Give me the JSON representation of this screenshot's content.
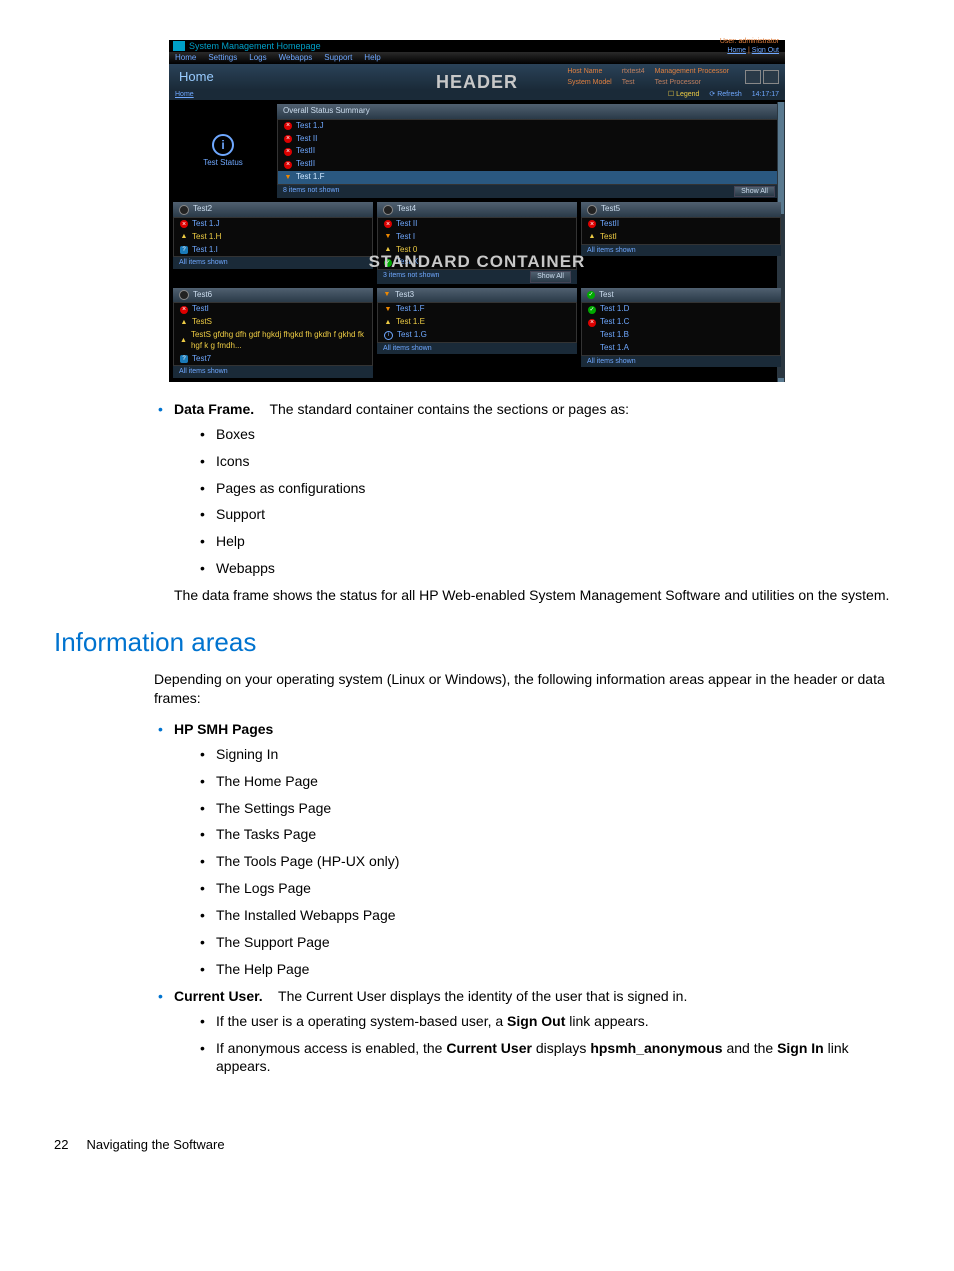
{
  "figure": {
    "app_title": "System Management Homepage",
    "top_right": {
      "user_label": "User: administrator",
      "home": "Home",
      "sign_out": "Sign Out"
    },
    "menu": [
      "Home",
      "Settings",
      "Logs",
      "Webapps",
      "Support",
      "Help"
    ],
    "page_name": "Home",
    "header_overlay": "HEADER",
    "host_info": {
      "host_name_label": "Host Name",
      "host_name": "rtxtest4",
      "system_model_label": "System Model",
      "system_model": "Test",
      "mp_label": "Management Processor",
      "mp_value": "Test Processor"
    },
    "breadcrumb": "Home",
    "strip_right": {
      "legend": "Legend",
      "refresh": "Refresh",
      "time": "14:17:17"
    },
    "test_status_label": "Test Status",
    "summary": {
      "title": "Overall Status Summary",
      "items": [
        {
          "icon": "crit",
          "label": "Test 1.J"
        },
        {
          "icon": "crit",
          "label": "Test II"
        },
        {
          "icon": "crit",
          "label": "TestII"
        },
        {
          "icon": "crit",
          "label": "TestII"
        },
        {
          "icon": "warn-maj",
          "label": "Test 1.F",
          "sel": true
        }
      ],
      "footer_left": "8 items not shown",
      "footer_btn": "Show All"
    },
    "container_overlay": "STANDARD CONTAINER",
    "grid": {
      "row1": [
        {
          "hdr_icon": "dis",
          "title": "Test2",
          "items": [
            {
              "icon": "crit",
              "label": "Test 1.J"
            },
            {
              "icon": "warn-min",
              "label": "Test 1.H",
              "cls": "warn-line"
            },
            {
              "icon": "unk",
              "label": "Test 1.I"
            }
          ],
          "ftr": "All items shown"
        },
        {
          "hdr_icon": "dis",
          "title": "Test4",
          "items": [
            {
              "icon": "crit",
              "label": "Test II"
            },
            {
              "icon": "warn-maj",
              "label": "Test I"
            },
            {
              "icon": "warn-min",
              "label": "Test 0",
              "cls": "warn-line"
            },
            {
              "icon": "ok",
              "label": "Test X"
            }
          ],
          "ftr": "3 items not shown",
          "btn": "Show All"
        },
        {
          "hdr_icon": "dis",
          "title": "Test5",
          "items": [
            {
              "icon": "crit",
              "label": "TestII"
            },
            {
              "icon": "warn-min",
              "label": "TestI",
              "cls": "warn-line"
            }
          ],
          "ftr": "All items shown"
        }
      ],
      "row2": [
        {
          "hdr_icon": "dis",
          "title": "Test6",
          "items": [
            {
              "icon": "crit",
              "label": "TestI"
            },
            {
              "icon": "warn-min",
              "label": "TestS",
              "cls": "warn-line"
            },
            {
              "icon": "warn-min",
              "label": "TestS gfdhg dfh gdf hgkdj fhgkd fh gkdh f gkhd fk hgf k g fmdh...",
              "cls": "warn-line"
            },
            {
              "icon": "unk",
              "label": "Test7"
            }
          ],
          "ftr": "All items shown"
        },
        {
          "hdr_icon": "warn-maj",
          "title": "Test3",
          "items": [
            {
              "icon": "warn-maj",
              "label": "Test 1.F"
            },
            {
              "icon": "warn-min",
              "label": "Test 1.E",
              "cls": "warn-line"
            },
            {
              "icon": "info",
              "label": "Test 1.G"
            }
          ],
          "ftr": "All items shown"
        },
        {
          "hdr_icon": "ok",
          "title": "Test",
          "items": [
            {
              "icon": "ok",
              "label": "Test 1.D"
            },
            {
              "icon": "crit",
              "label": "Test 1.C"
            },
            {
              "icon": "",
              "label": "Test 1.B"
            },
            {
              "icon": "",
              "label": "Test 1.A"
            }
          ],
          "ftr": "All items shown"
        }
      ]
    }
  },
  "doc": {
    "data_frame_term": "Data Frame.",
    "data_frame_text": "The standard container contains the sections or pages as:",
    "data_frame_items": [
      "Boxes",
      "Icons",
      "Pages as configurations",
      "Support",
      "Help",
      "Webapps"
    ],
    "data_frame_para": "The data frame shows the status for all HP Web-enabled System Management Software and utilities on the system.",
    "section_title": "Information areas",
    "section_intro": "Depending on your operating system (Linux or Windows), the following information areas appear in the header or data frames:",
    "smh_pages_label": "HP SMH Pages",
    "smh_pages": [
      "Signing In",
      "The Home Page",
      "The Settings Page",
      "The Tasks Page",
      "The Tools Page (HP-UX only)",
      "The Logs Page",
      "The Installed Webapps Page",
      "The Support Page",
      "The Help Page"
    ],
    "current_user_term": "Current User.",
    "current_user_text": "The Current User displays the identity of the user that is signed in.",
    "cu_sub1_a": "If the user is a operating system-based user, a ",
    "cu_sub1_b": "Sign Out",
    "cu_sub1_c": " link appears.",
    "cu_sub2_a": "If anonymous access is enabled, the ",
    "cu_sub2_b": "Current User",
    "cu_sub2_c": " displays ",
    "cu_sub2_d": "hpsmh_anonymous",
    "cu_sub2_e": " and the ",
    "cu_sub2_f": "Sign In",
    "cu_sub2_g": " link appears."
  },
  "footer": {
    "page": "22",
    "title": "Navigating the Software"
  }
}
